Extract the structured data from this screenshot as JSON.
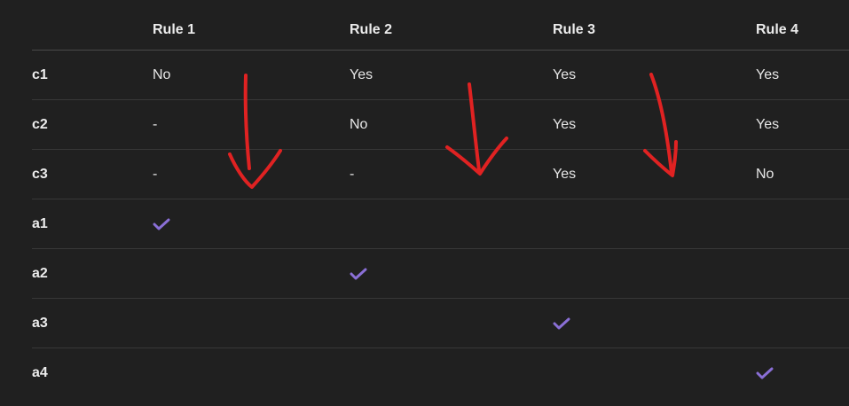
{
  "table": {
    "headers": [
      "",
      "Rule 1",
      "Rule 2",
      "Rule 3",
      "Rule 4"
    ],
    "rows": [
      {
        "label": "c1",
        "cells": [
          "No",
          "Yes",
          "Yes",
          "Yes"
        ]
      },
      {
        "label": "c2",
        "cells": [
          "-",
          "No",
          "Yes",
          "Yes"
        ]
      },
      {
        "label": "c3",
        "cells": [
          "-",
          "-",
          "Yes",
          "No"
        ]
      },
      {
        "label": "a1",
        "cells": [
          "",
          "",
          "",
          ""
        ],
        "check_rule": 1
      },
      {
        "label": "a2",
        "cells": [
          "",
          "",
          "",
          ""
        ],
        "check_rule": 2
      },
      {
        "label": "a3",
        "cells": [
          "",
          "",
          "",
          ""
        ],
        "check_rule": 3
      },
      {
        "label": "a4",
        "cells": [
          "",
          "",
          "",
          ""
        ],
        "check_rule": 4
      }
    ]
  },
  "icons": {
    "check": "checkmark-icon",
    "arrow": "down-arrow-annotation-icon"
  },
  "colors": {
    "background": "#202020",
    "text": "#e6e6e6",
    "check": "#8a6fd6",
    "annotation": "#e02222",
    "divider": "#383838"
  }
}
